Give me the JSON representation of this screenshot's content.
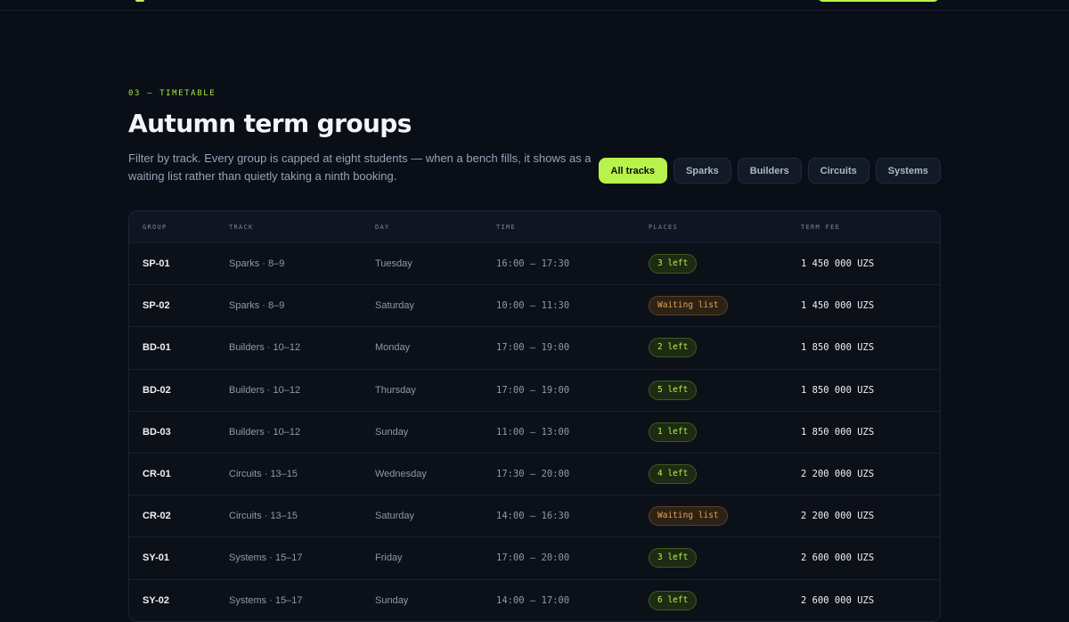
{
  "section": {
    "eyebrow": "03 — TIMETABLE",
    "title": "Autumn term groups",
    "lede": "Filter by track. Every group is capped at eight students — when a bench fills, it shows as a waiting list rather than quietly taking a ninth booking."
  },
  "filters": [
    {
      "label": "All tracks",
      "active": true
    },
    {
      "label": "Sparks",
      "active": false
    },
    {
      "label": "Builders",
      "active": false
    },
    {
      "label": "Circuits",
      "active": false
    },
    {
      "label": "Systems",
      "active": false
    }
  ],
  "table": {
    "headers": [
      "GROUP",
      "TRACK",
      "DAY",
      "TIME",
      "PLACES",
      "TERM FEE"
    ],
    "rows": [
      {
        "group": "SP-01",
        "track": "Sparks · 8–9",
        "day": "Tuesday",
        "time": "16:00 — 17:30",
        "places": "3 left",
        "status": "open",
        "fee": "1 450 000 UZS"
      },
      {
        "group": "SP-02",
        "track": "Sparks · 8–9",
        "day": "Saturday",
        "time": "10:00 — 11:30",
        "places": "Waiting list",
        "status": "wait",
        "fee": "1 450 000 UZS"
      },
      {
        "group": "BD-01",
        "track": "Builders · 10–12",
        "day": "Monday",
        "time": "17:00 — 19:00",
        "places": "2 left",
        "status": "open",
        "fee": "1 850 000 UZS"
      },
      {
        "group": "BD-02",
        "track": "Builders · 10–12",
        "day": "Thursday",
        "time": "17:00 — 19:00",
        "places": "5 left",
        "status": "open",
        "fee": "1 850 000 UZS"
      },
      {
        "group": "BD-03",
        "track": "Builders · 10–12",
        "day": "Sunday",
        "time": "11:00 — 13:00",
        "places": "1 left",
        "status": "open",
        "fee": "1 850 000 UZS"
      },
      {
        "group": "CR-01",
        "track": "Circuits · 13–15",
        "day": "Wednesday",
        "time": "17:30 — 20:00",
        "places": "4 left",
        "status": "open",
        "fee": "2 200 000 UZS"
      },
      {
        "group": "CR-02",
        "track": "Circuits · 13–15",
        "day": "Saturday",
        "time": "14:00 — 16:30",
        "places": "Waiting list",
        "status": "wait",
        "fee": "2 200 000 UZS"
      },
      {
        "group": "SY-01",
        "track": "Systems · 15–17",
        "day": "Friday",
        "time": "17:00 — 20:00",
        "places": "3 left",
        "status": "open",
        "fee": "2 600 000 UZS"
      },
      {
        "group": "SY-02",
        "track": "Systems · 15–17",
        "day": "Sunday",
        "time": "14:00 — 17:00",
        "places": "6 left",
        "status": "open",
        "fee": "2 600 000 UZS"
      }
    ]
  },
  "colors": {
    "accent": "#b7f34a",
    "waiting": "#e8a24a",
    "background": "#0a0e17"
  }
}
